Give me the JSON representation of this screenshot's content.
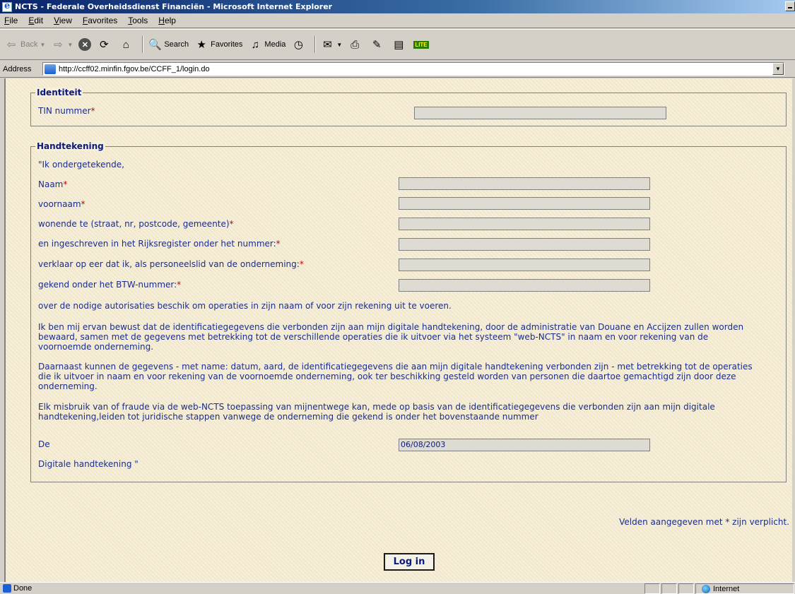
{
  "window": {
    "title": "NCTS - Federale Overheidsdienst Financiën - Microsoft Internet Explorer"
  },
  "menu": {
    "items": [
      "File",
      "Edit",
      "View",
      "Favorites",
      "Tools",
      "Help"
    ]
  },
  "toolbar": {
    "back": "Back",
    "search": "Search",
    "favorites": "Favorites",
    "media": "Media",
    "lite": "LITE"
  },
  "address": {
    "label": "Address",
    "url": "http://ccff02.minfin.fgov.be/CCFF_1/login.do"
  },
  "identiteit": {
    "legend": "Identiteit",
    "tin_label": "TIN nummer",
    "tin_value": ""
  },
  "handtekening": {
    "legend": "Handtekening",
    "intro": "\"Ik ondergetekende,",
    "fields": [
      {
        "label": "Naam",
        "value": ""
      },
      {
        "label": "voornaam",
        "value": ""
      },
      {
        "label": "wonende te (straat, nr, postcode, gemeente)",
        "value": ""
      },
      {
        "label": "en ingeschreven in het Rijksregister onder het nummer:",
        "value": ""
      },
      {
        "label": "verklaar op eer dat ik, als personeelslid van de onderneming:",
        "value": ""
      },
      {
        "label": "gekend onder het BTW-nummer:",
        "value": ""
      }
    ],
    "para1": "over de nodige autorisaties beschik om operaties in zijn naam of voor zijn rekening uit te voeren.",
    "para2": "Ik ben mij ervan bewust dat de identificatiegegevens die verbonden zijn aan mijn digitale handtekening, door de administratie van Douane en Accijzen zullen worden bewaard, samen met de gegevens met betrekking tot de verschillende operaties die ik uitvoer via het systeem \"web-NCTS\" in naam en voor rekening van de voornoemde onderneming.",
    "para3": "Daarnaast kunnen de gegevens - met name: datum, aard, de identificatiegegevens die aan mijn digitale handtekening verbonden zijn - met betrekking tot de operaties die ik uitvoer in naam en voor rekening van de voornoemde onderneming, ook ter beschikking gesteld worden van personen die daartoe gemachtigd zijn door deze onderneming.",
    "para4": "Elk misbruik van of fraude via de web-NCTS toepassing van mijnentwege kan, mede op basis van de identificatiegegevens die verbonden zijn aan mijn digitale handtekening,leiden tot juridische stappen vanwege de onderneming die gekend is onder het bovenstaande nummer",
    "date_label": "De",
    "date_value": "06/08/2003",
    "signature_label": "Digitale handtekening \""
  },
  "required_mark": "*",
  "footnote": "Velden aangegeven met * zijn verplicht.",
  "login_button": "Log in",
  "status": {
    "text": "Done",
    "zone": "Internet"
  }
}
